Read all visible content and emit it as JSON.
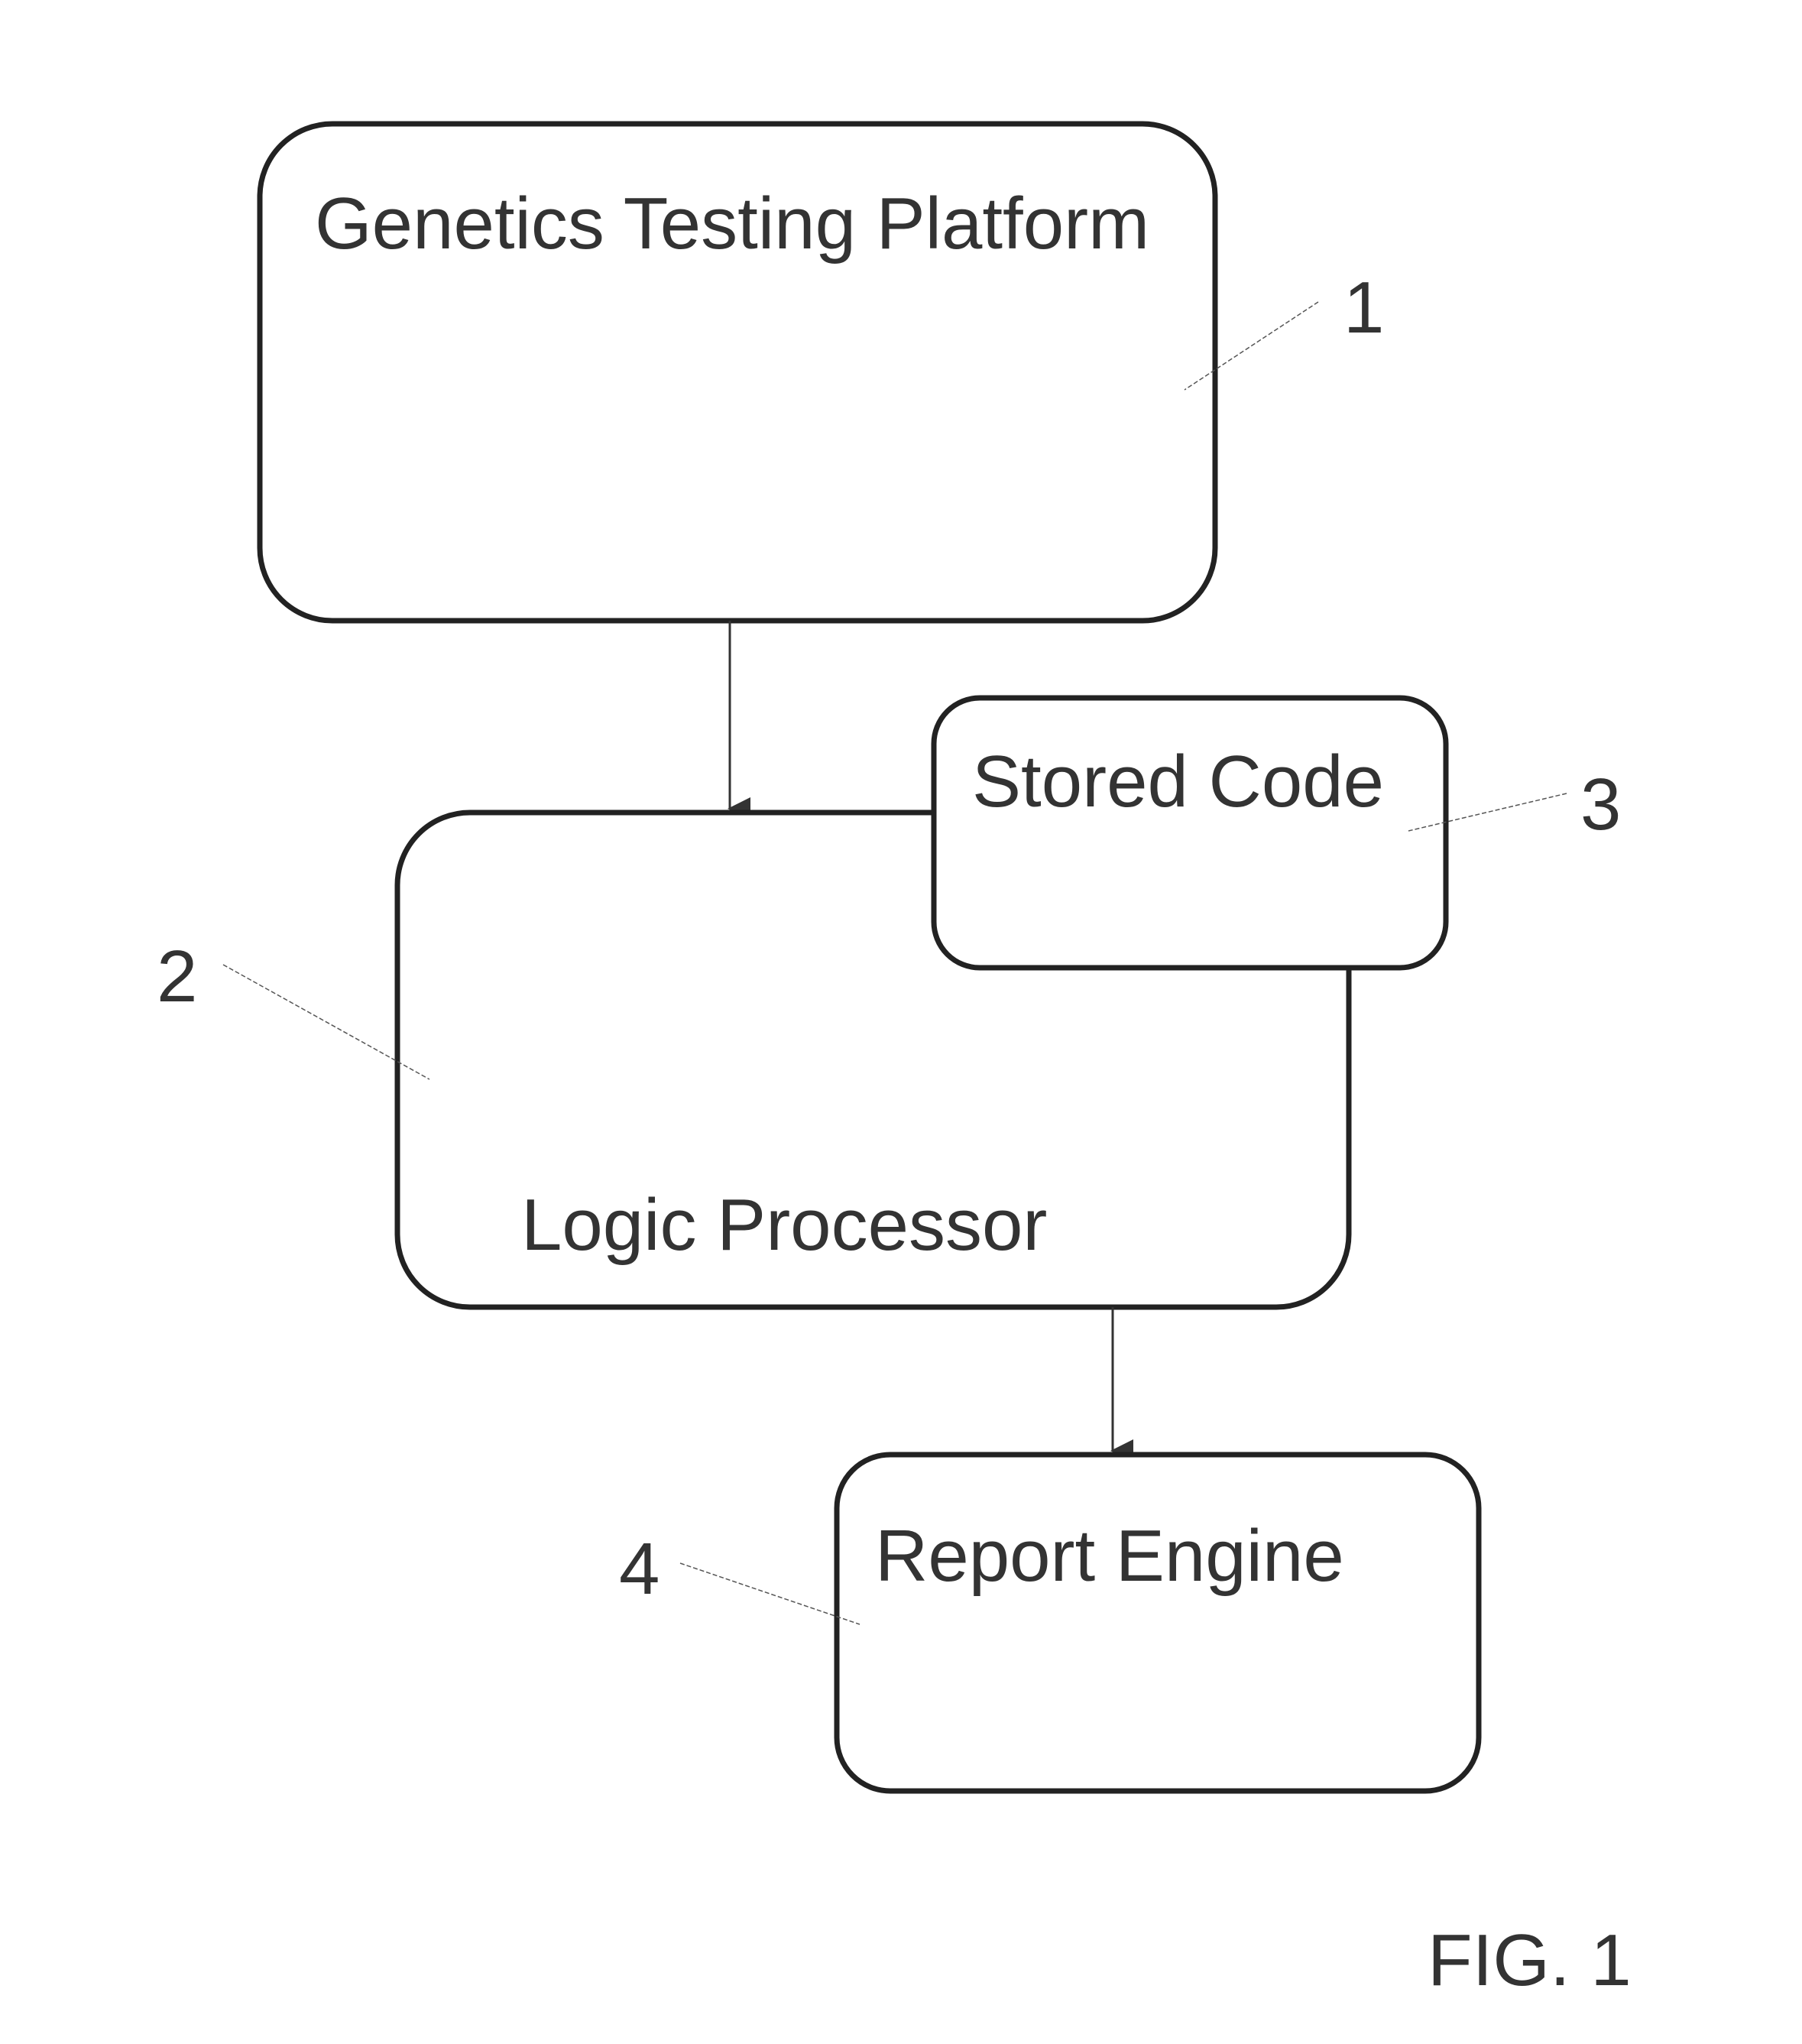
{
  "figure": {
    "label": "FIG. 1",
    "nodes": [
      {
        "id": "1",
        "label": "Genetics Testing Platform"
      },
      {
        "id": "2",
        "label": "Logic Processor"
      },
      {
        "id": "3",
        "label": "Stored Code"
      },
      {
        "id": "4",
        "label": "Report Engine"
      }
    ],
    "edges": [
      {
        "from": "1",
        "to": "2"
      },
      {
        "from": "2",
        "to": "4"
      }
    ],
    "reference_numerals": [
      "1",
      "2",
      "3",
      "4"
    ]
  }
}
